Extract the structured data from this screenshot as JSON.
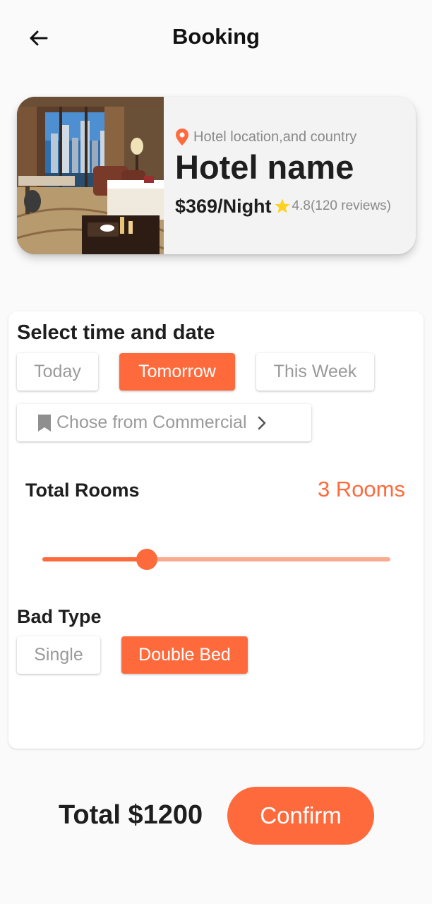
{
  "header": {
    "title": "Booking"
  },
  "hotel": {
    "location": "Hotel location,and country",
    "name": "Hotel name",
    "price": "$369/Night",
    "rating": "4.8(120 reviews)"
  },
  "schedule": {
    "title": "Select time and date",
    "options": [
      "Today",
      "Tomorrow",
      "This Week"
    ],
    "selected": "Tomorrow",
    "commercial_label": "Chose from Commercial"
  },
  "rooms": {
    "label": "Total Rooms",
    "value": "3 Rooms",
    "slider_fraction": 0.3
  },
  "bed": {
    "title": "Bad Type",
    "options": [
      "Single",
      "Double Bed"
    ],
    "selected": "Double Bed"
  },
  "footer": {
    "total": "Total $1200",
    "confirm_label": "Confirm"
  },
  "colors": {
    "accent": "#ff6a3d",
    "accent_light": "#f9aa8f",
    "star": "#ffd21f"
  },
  "icons": [
    "back-arrow-icon",
    "location-pin-icon",
    "star-icon",
    "bookmark-icon",
    "chevron-right-icon"
  ]
}
